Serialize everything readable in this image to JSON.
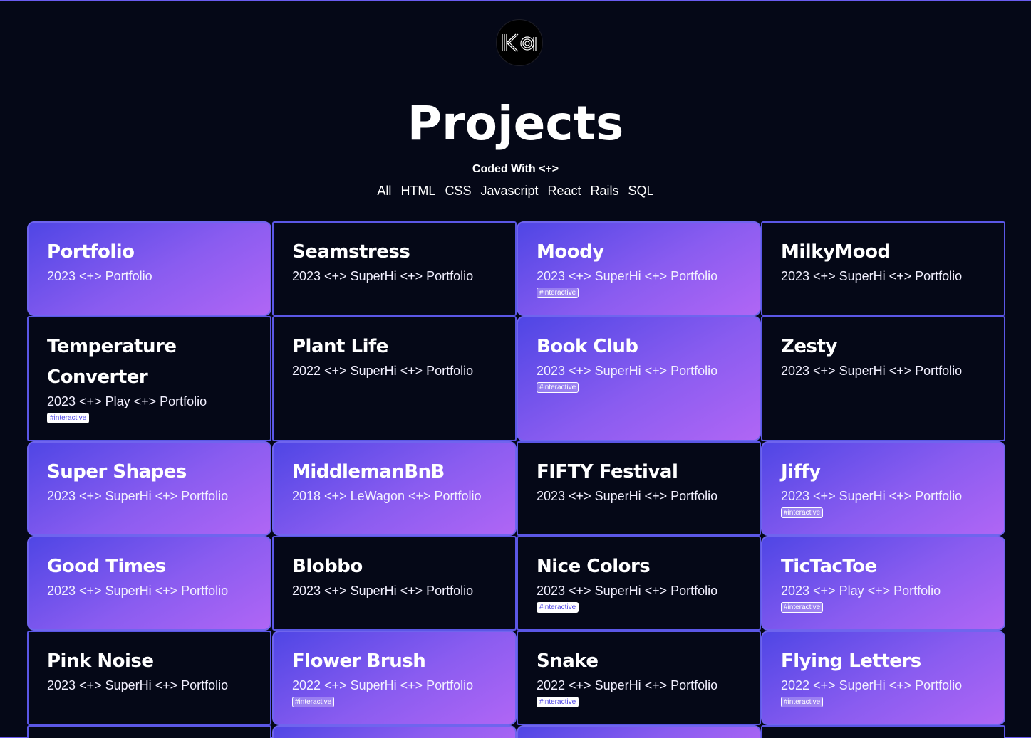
{
  "header": {
    "logo_text": "ka",
    "title": "Projects",
    "subtitle": "Coded With <+>",
    "filters": [
      "All",
      "HTML",
      "CSS",
      "Javascript",
      "React",
      "Rails",
      "SQL"
    ]
  },
  "colors": {
    "background": "#050817",
    "accent_border": "#5b57e6",
    "gradient_start": "#4f46e5",
    "gradient_end": "#b066f5"
  },
  "projects": [
    {
      "title": "Portfolio",
      "meta": "2023 <+> Portfolio",
      "tag": "",
      "style": "grad"
    },
    {
      "title": "Seamstress",
      "meta": "2023 <+> SuperHi <+> Portfolio",
      "tag": "",
      "style": "dark"
    },
    {
      "title": "Moody",
      "meta": "2023 <+> SuperHi <+> Portfolio",
      "tag": "#interactive",
      "style": "grad"
    },
    {
      "title": "MilkyMood",
      "meta": "2023 <+> SuperHi <+> Portfolio",
      "tag": "",
      "style": "dark"
    },
    {
      "title": "Temperature Converter",
      "meta": "2023 <+> Play <+> Portfolio",
      "tag": "#interactive",
      "style": "dark"
    },
    {
      "title": "Plant Life",
      "meta": "2022 <+> SuperHi <+> Portfolio",
      "tag": "",
      "style": "dark"
    },
    {
      "title": "Book Club",
      "meta": "2023 <+> SuperHi <+> Portfolio",
      "tag": "#interactive",
      "style": "grad"
    },
    {
      "title": "Zesty",
      "meta": "2023 <+> SuperHi <+> Portfolio",
      "tag": "",
      "style": "dark"
    },
    {
      "title": "Super Shapes",
      "meta": "2023 <+> SuperHi <+> Portfolio",
      "tag": "",
      "style": "grad"
    },
    {
      "title": "MiddlemanBnB",
      "meta": "2018 <+> LeWagon <+> Portfolio",
      "tag": "",
      "style": "grad"
    },
    {
      "title": "FIFTY Festival",
      "meta": "2023 <+> SuperHi <+> Portfolio",
      "tag": "",
      "style": "dark"
    },
    {
      "title": "Jiffy",
      "meta": "2023 <+> SuperHi <+> Portfolio",
      "tag": "#interactive",
      "style": "grad"
    },
    {
      "title": "Good Times",
      "meta": "2023 <+> SuperHi <+> Portfolio",
      "tag": "",
      "style": "grad"
    },
    {
      "title": "Blobbo",
      "meta": "2023 <+> SuperHi <+> Portfolio",
      "tag": "",
      "style": "dark"
    },
    {
      "title": "Nice Colors",
      "meta": "2023 <+> SuperHi <+> Portfolio",
      "tag": "#interactive",
      "style": "dark"
    },
    {
      "title": "TicTacToe",
      "meta": "2023 <+> Play <+> Portfolio",
      "tag": "#interactive",
      "style": "grad"
    },
    {
      "title": "Pink Noise",
      "meta": "2023 <+> SuperHi <+> Portfolio",
      "tag": "",
      "style": "dark"
    },
    {
      "title": "Flower Brush",
      "meta": "2022 <+> SuperHi <+> Portfolio",
      "tag": "#interactive",
      "style": "grad"
    },
    {
      "title": "Snake",
      "meta": "2022 <+> SuperHi <+> Portfolio",
      "tag": "#interactive",
      "style": "dark"
    },
    {
      "title": "Flying Letters",
      "meta": "2022 <+> SuperHi <+> Portfolio",
      "tag": "#interactive",
      "style": "grad"
    },
    {
      "title": "",
      "meta": "",
      "tag": "",
      "style": "dark"
    },
    {
      "title": "",
      "meta": "",
      "tag": "",
      "style": "grad"
    },
    {
      "title": "",
      "meta": "",
      "tag": "",
      "style": "grad"
    },
    {
      "title": "",
      "meta": "",
      "tag": "",
      "style": "dark"
    }
  ]
}
